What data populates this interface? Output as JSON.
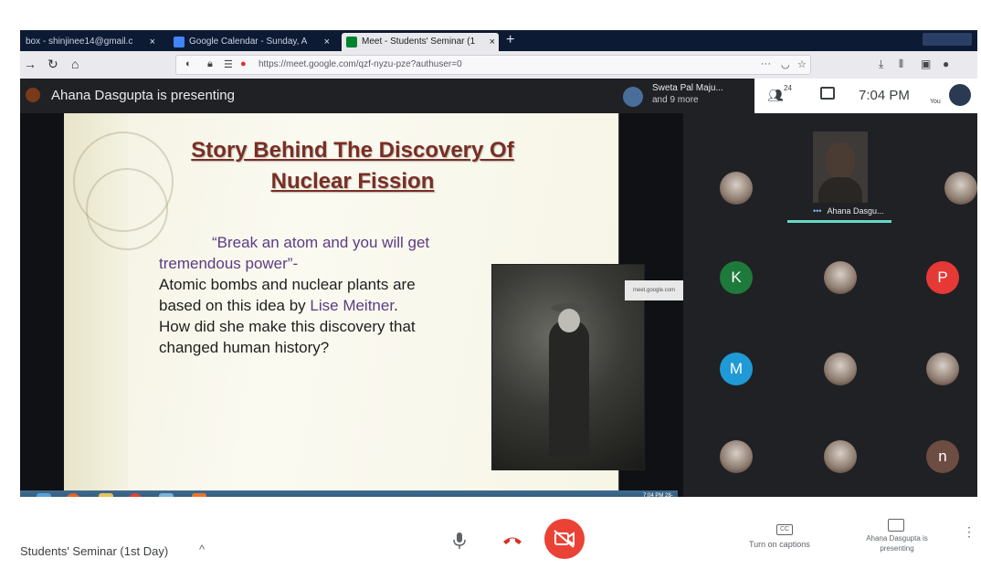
{
  "browser": {
    "tabs": [
      {
        "label": "box - shinjinee14@gmail.c",
        "close": "×"
      },
      {
        "label": "Google Calendar - Sunday, A",
        "close": "×"
      },
      {
        "label": "Meet - Students' Seminar (1",
        "close": "×"
      }
    ],
    "new_tab": "+",
    "url": "https://meet.google.com/qzf-nyzu-pze?authuser=0",
    "url_more": "···"
  },
  "meet": {
    "presenting_text": "Ahana Dasgupta is presenting",
    "others_name": "Sweta Pal Maju...",
    "others_more": "and 9 more",
    "people_count": "24",
    "time": "7:04 PM",
    "you_label": "You"
  },
  "slide": {
    "title_line1": "Story Behind The Discovery Of",
    "title_line2": "Nuclear Fission",
    "quote": "“Break an atom and you will get tremendous power”-",
    "body_before": "Atomic bombs and nuclear plants are based on this idea by ",
    "body_name": "Lise Meitner",
    "body_after": ". How did she make this discovery that changed human history?"
  },
  "screen_url_chip": "meet.google.com",
  "taskbar_clock": "7:04 PM 28-Apr-21",
  "participants": {
    "speaker_name": "Ahana Dasgu...",
    "speaker_dots": "•••",
    "initials": [
      "K",
      "P",
      "M",
      "n"
    ]
  },
  "bottom": {
    "meeting_title": "Students' Seminar (1st Day)",
    "chevron": "^",
    "cc_icon": "CC",
    "captions_label": "Turn on captions",
    "presenting_label": "Ahana Dasgupta is presenting",
    "kebab": "⋮"
  },
  "colors": {
    "cam_off": "#ea4335",
    "avatar_k": "#1e7a3a",
    "avatar_p": "#e53935",
    "avatar_m": "#1f9ad6",
    "avatar_n": "#6d4c41",
    "speaking_bar": "#67d7c6"
  }
}
